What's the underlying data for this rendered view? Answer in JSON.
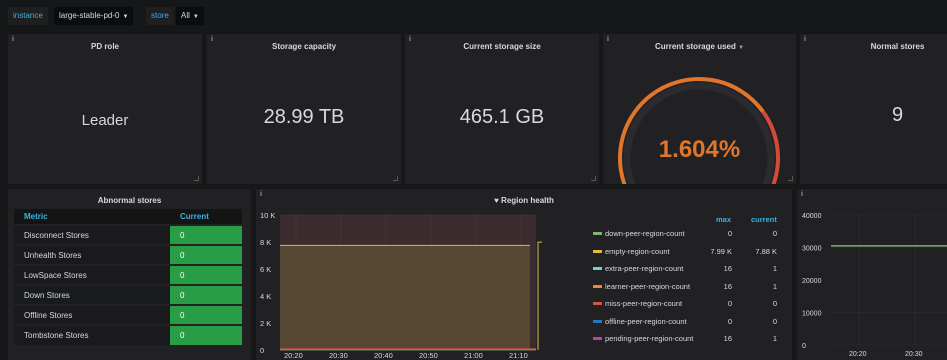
{
  "variables": [
    {
      "label": "instance",
      "value": "large-stable-pd-0"
    },
    {
      "label": "store",
      "value": "All"
    }
  ],
  "panels": {
    "pd_role": {
      "title": "PD role",
      "value": "Leader"
    },
    "storage_capacity": {
      "title": "Storage capacity",
      "value": "28.99 TB"
    },
    "current_storage_size": {
      "title": "Current storage size",
      "value": "465.1 GB"
    },
    "current_storage_used": {
      "title": "Current storage used",
      "value": "1.604%",
      "fraction": 0.01604,
      "gauge_colors": [
        "#299c46",
        "#e0752d",
        "#d44a3a"
      ]
    },
    "normal_stores": {
      "title": "Normal stores",
      "value": "9"
    },
    "abnormal_stores": {
      "title": "Abnormal stores",
      "columns": [
        "Metric",
        "Current"
      ],
      "rows": [
        {
          "metric": "Disconnect Stores",
          "current": "0"
        },
        {
          "metric": "Unhealth Stores",
          "current": "0"
        },
        {
          "metric": "LowSpace Stores",
          "current": "0"
        },
        {
          "metric": "Down Stores",
          "current": "0"
        },
        {
          "metric": "Offline Stores",
          "current": "0"
        },
        {
          "metric": "Tombstone Stores",
          "current": "0"
        }
      ]
    },
    "region_health": {
      "title": "Region health",
      "y_ticks": [
        "10 K",
        "8 K",
        "6 K",
        "4 K",
        "2 K",
        "0"
      ],
      "x_ticks": [
        "20:20",
        "20:30",
        "20:40",
        "20:50",
        "21:00",
        "21:10"
      ],
      "legend_headers": [
        "max",
        "current"
      ],
      "legend": [
        {
          "name": "down-peer-region-count",
          "max": "0",
          "current": "0",
          "color": "#7eb26d"
        },
        {
          "name": "empty-region-count",
          "max": "7.99 K",
          "current": "7.88 K",
          "color": "#eab839"
        },
        {
          "name": "extra-peer-region-count",
          "max": "16",
          "current": "1",
          "color": "#6ed0e0"
        },
        {
          "name": "learner-peer-region-count",
          "max": "16",
          "current": "1",
          "color": "#ef843c"
        },
        {
          "name": "miss-peer-region-count",
          "max": "0",
          "current": "0",
          "color": "#e24d42"
        },
        {
          "name": "offline-peer-region-count",
          "max": "0",
          "current": "0",
          "color": "#1f78c1"
        },
        {
          "name": "pending-peer-region-count",
          "max": "16",
          "current": "1",
          "color": "#ba43a9"
        }
      ]
    },
    "right_graph": {
      "y_ticks": [
        "40000",
        "30000",
        "20000",
        "10000",
        "0"
      ],
      "x_ticks": [
        "20:20",
        "20:30"
      ]
    }
  },
  "chart_data": [
    {
      "type": "line",
      "title": "Region health",
      "x": [
        "20:20",
        "20:30",
        "20:40",
        "20:50",
        "21:00",
        "21:10"
      ],
      "ylim": [
        0,
        10000
      ],
      "series": [
        {
          "name": "empty-region-count",
          "values": [
            7750,
            7750,
            7750,
            7750,
            7750,
            7990
          ]
        },
        {
          "name": "down-peer-region-count",
          "values": [
            0,
            0,
            0,
            0,
            0,
            0
          ]
        },
        {
          "name": "miss-peer-region-count",
          "values": [
            0,
            0,
            0,
            0,
            0,
            0
          ]
        }
      ]
    },
    {
      "type": "line",
      "x": [
        "20:20",
        "20:30"
      ],
      "ylim": [
        0,
        40000
      ],
      "series": [
        {
          "values": [
            30500,
            30500
          ]
        }
      ]
    }
  ]
}
